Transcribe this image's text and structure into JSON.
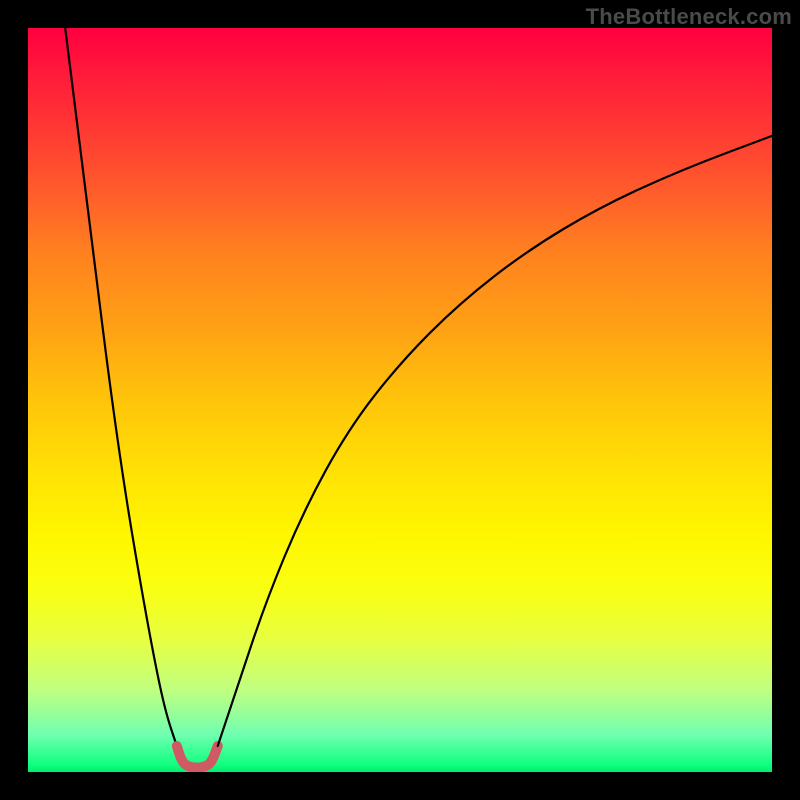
{
  "watermark": "TheBottleneck.com",
  "chart_data": {
    "type": "line",
    "title": "",
    "xlabel": "",
    "ylabel": "",
    "xlim": [
      0,
      100
    ],
    "ylim": [
      0,
      100
    ],
    "curves": [
      {
        "name": "left-branch",
        "points": [
          {
            "x": 5,
            "y": 100
          },
          {
            "x": 7,
            "y": 84
          },
          {
            "x": 9,
            "y": 68
          },
          {
            "x": 11,
            "y": 52
          },
          {
            "x": 13,
            "y": 38
          },
          {
            "x": 15,
            "y": 26
          },
          {
            "x": 17,
            "y": 15
          },
          {
            "x": 18.5,
            "y": 8
          },
          {
            "x": 20,
            "y": 3.5
          }
        ]
      },
      {
        "name": "trough",
        "points": [
          {
            "x": 20,
            "y": 3.5
          },
          {
            "x": 20.7,
            "y": 1.3
          },
          {
            "x": 21.8,
            "y": 0.6
          },
          {
            "x": 23.6,
            "y": 0.6
          },
          {
            "x": 24.7,
            "y": 1.3
          },
          {
            "x": 25.5,
            "y": 3.5
          }
        ],
        "stroke": "#d05a64",
        "stroke_width": 10
      },
      {
        "name": "right-branch",
        "points": [
          {
            "x": 25.5,
            "y": 3.5
          },
          {
            "x": 28,
            "y": 11
          },
          {
            "x": 32,
            "y": 23
          },
          {
            "x": 37,
            "y": 35
          },
          {
            "x": 43,
            "y": 46
          },
          {
            "x": 50,
            "y": 55
          },
          {
            "x": 58,
            "y": 63
          },
          {
            "x": 67,
            "y": 70
          },
          {
            "x": 77,
            "y": 76
          },
          {
            "x": 88,
            "y": 81
          },
          {
            "x": 100,
            "y": 85.5
          }
        ]
      }
    ],
    "background": {
      "type": "vertical-gradient",
      "top_color": "#ff0040",
      "mid_color": "#ffe600",
      "bottom_color": "#00ee70"
    }
  }
}
